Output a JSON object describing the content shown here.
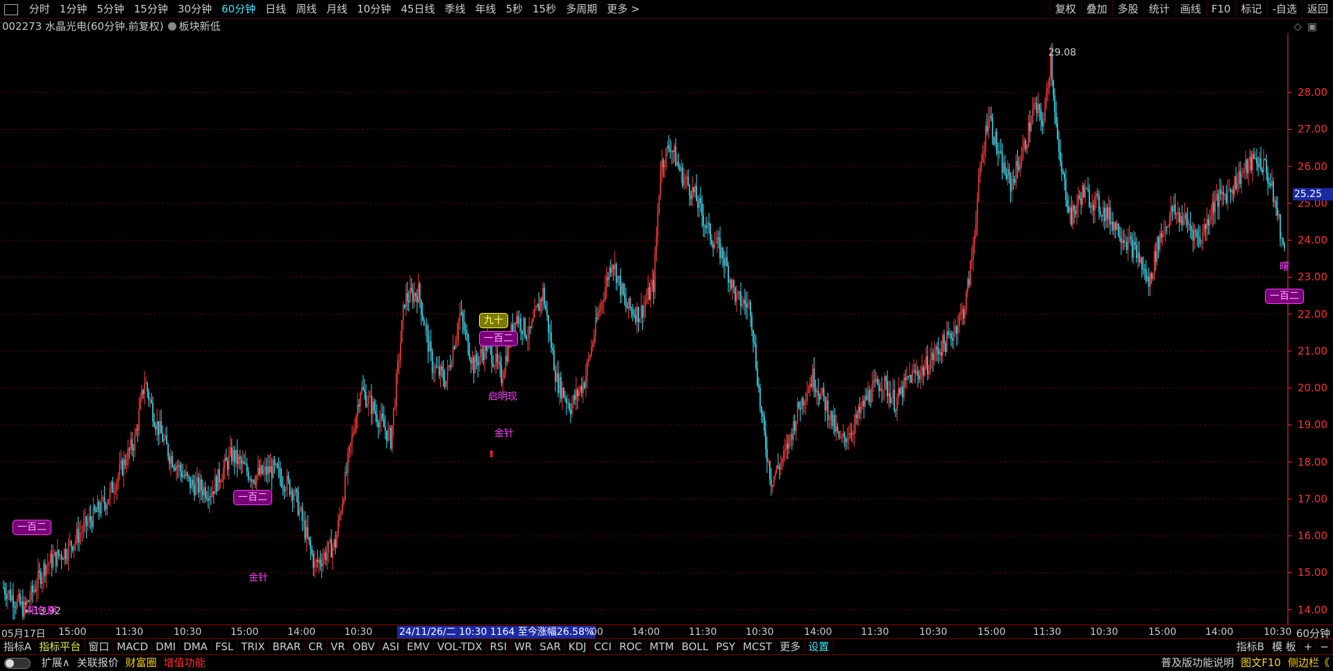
{
  "topbar": {
    "periods": [
      "分时",
      "1分钟",
      "5分钟",
      "15分钟",
      "30分钟",
      "60分钟",
      "日线",
      "周线",
      "月线",
      "10分钟",
      "45日线",
      "季线",
      "年线",
      "5秒",
      "15秒",
      "多周期",
      "更多 >"
    ],
    "active_period": "60分钟",
    "right_items": [
      "复权",
      "叠加",
      "多股",
      "统计",
      "画线",
      "F10",
      "标记",
      "-自选",
      "返回"
    ]
  },
  "title": {
    "code_name": "002273 水晶光电(60分钟.前复权)",
    "sector_label": "板块新低"
  },
  "price_axis": {
    "labels": [
      "28.00",
      "27.00",
      "26.00",
      "25.00",
      "24.00",
      "23.00",
      "22.00",
      "21.00",
      "20.00",
      "19.00",
      "18.00",
      "17.00",
      "16.00",
      "15.00",
      "14.00"
    ],
    "current_price": "25.25"
  },
  "chart_data": {
    "type": "candlestick",
    "title": "002273 水晶光电(60分钟.前复权)",
    "ylim": [
      13.6,
      29.6
    ],
    "high_label": "29.08",
    "low_label": "13.92",
    "x_tick_labels": [
      "05月17日",
      "15:00",
      "11:30",
      "10:30",
      "15:00",
      "14:00",
      "10:30",
      "24/11/26/二 10:30 1164 至今涨幅26.58%",
      "00",
      "14:00",
      "11:30",
      "10:30",
      "14:00",
      "11:30",
      "10:30",
      "15:00",
      "11:30",
      "10:30",
      "15:00",
      "14:00",
      "10:30"
    ],
    "anchors": [
      [
        0,
        14.6
      ],
      [
        15,
        14.0
      ],
      [
        30,
        15.2
      ],
      [
        45,
        15.6
      ],
      [
        60,
        16.3
      ],
      [
        75,
        17.0
      ],
      [
        85,
        17.8
      ],
      [
        95,
        18.6
      ],
      [
        102,
        20.2
      ],
      [
        110,
        19.1
      ],
      [
        120,
        18.2
      ],
      [
        135,
        17.4
      ],
      [
        150,
        17.2
      ],
      [
        165,
        18.2
      ],
      [
        180,
        17.6
      ],
      [
        195,
        17.8
      ],
      [
        210,
        17.2
      ],
      [
        225,
        15.2
      ],
      [
        240,
        15.8
      ],
      [
        250,
        18.2
      ],
      [
        258,
        20.0
      ],
      [
        268,
        19.4
      ],
      [
        280,
        18.6
      ],
      [
        290,
        22.4
      ],
      [
        300,
        22.6
      ],
      [
        310,
        20.6
      ],
      [
        320,
        20.2
      ],
      [
        330,
        22.0
      ],
      [
        340,
        20.6
      ],
      [
        350,
        21.2
      ],
      [
        360,
        20.3
      ],
      [
        370,
        22.0
      ],
      [
        380,
        21.4
      ],
      [
        390,
        22.6
      ],
      [
        395,
        21.4
      ],
      [
        400,
        20.2
      ],
      [
        410,
        19.5
      ],
      [
        420,
        20.2
      ],
      [
        430,
        22.0
      ],
      [
        440,
        23.5
      ],
      [
        450,
        22.2
      ],
      [
        460,
        22.0
      ],
      [
        470,
        22.8
      ],
      [
        475,
        26.0
      ],
      [
        482,
        26.6
      ],
      [
        490,
        25.8
      ],
      [
        500,
        25.2
      ],
      [
        510,
        24.2
      ],
      [
        520,
        23.6
      ],
      [
        530,
        22.4
      ],
      [
        540,
        22.2
      ],
      [
        548,
        19.2
      ],
      [
        555,
        17.5
      ],
      [
        565,
        18.2
      ],
      [
        575,
        19.5
      ],
      [
        585,
        20.3
      ],
      [
        595,
        19.5
      ],
      [
        605,
        18.5
      ],
      [
        615,
        19.0
      ],
      [
        625,
        19.8
      ],
      [
        635,
        20.2
      ],
      [
        645,
        19.6
      ],
      [
        655,
        20.3
      ],
      [
        665,
        20.5
      ],
      [
        675,
        21.0
      ],
      [
        685,
        21.4
      ],
      [
        695,
        22.2
      ],
      [
        700,
        23.5
      ],
      [
        705,
        25.5
      ],
      [
        712,
        27.5
      ],
      [
        720,
        26.2
      ],
      [
        728,
        25.5
      ],
      [
        738,
        26.5
      ],
      [
        745,
        27.6
      ],
      [
        752,
        27.2
      ],
      [
        757,
        29.0
      ],
      [
        763,
        26.2
      ],
      [
        772,
        24.6
      ],
      [
        780,
        25.3
      ],
      [
        790,
        25.0
      ],
      [
        800,
        24.6
      ],
      [
        810,
        24.1
      ],
      [
        820,
        23.6
      ],
      [
        828,
        22.8
      ],
      [
        835,
        24.0
      ],
      [
        845,
        24.8
      ],
      [
        855,
        24.5
      ],
      [
        865,
        24.0
      ],
      [
        875,
        25.0
      ],
      [
        885,
        25.3
      ],
      [
        895,
        25.8
      ],
      [
        905,
        26.2
      ],
      [
        912,
        26.0
      ],
      [
        918,
        25.2
      ],
      [
        922,
        24.5
      ],
      [
        926,
        23.6
      ]
    ],
    "signal_tags": [
      {
        "text": "一百二",
        "style": "magenta"
      },
      {
        "text": "一百二",
        "style": "magenta"
      },
      {
        "text": "九十",
        "style": "yellow"
      },
      {
        "text": "一百二",
        "style": "magenta"
      },
      {
        "text": "一百二",
        "style": "magenta"
      }
    ],
    "signal_labels": [
      "阳包阴",
      "金针",
      "启明现",
      "金针",
      "曙"
    ]
  },
  "timeaxis": {
    "period_label": "60分钟"
  },
  "indicators": {
    "items": [
      "指标A",
      "指标平台",
      "窗口",
      "MACD",
      "DMI",
      "DMA",
      "FSL",
      "TRIX",
      "BRAR",
      "CR",
      "VR",
      "OBV",
      "ASI",
      "EMV",
      "VOL-TDX",
      "RSI",
      "WR",
      "SAR",
      "KDJ",
      "CCI",
      "ROC",
      "MTM",
      "BOLL",
      "PSY",
      "MCST",
      "更多",
      "设置"
    ],
    "right_items": [
      "指标B",
      "模 板",
      "+",
      "−"
    ]
  },
  "bottom": {
    "items": [
      "扩展∧",
      "关联报价",
      "财富圈",
      "增值功能"
    ],
    "right_items": [
      "普及版功能说明",
      "图文F10",
      "侧边栏《"
    ]
  },
  "colors": {
    "up": "#ff3c3c",
    "down": "#35e8ff",
    "grid": "#7a0000",
    "axis": "#ff3030"
  }
}
